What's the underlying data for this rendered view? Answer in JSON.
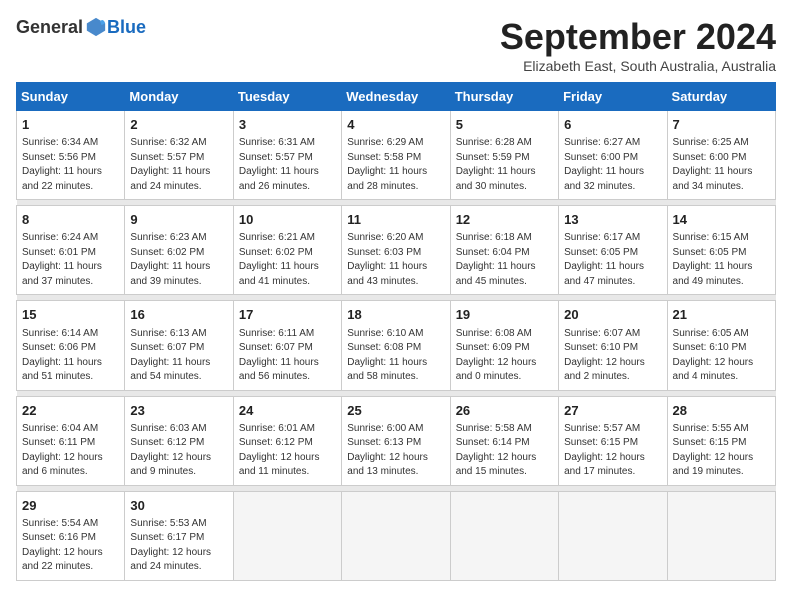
{
  "logo": {
    "general": "General",
    "blue": "Blue"
  },
  "title": {
    "month_year": "September 2024",
    "location": "Elizabeth East, South Australia, Australia"
  },
  "days_of_week": [
    "Sunday",
    "Monday",
    "Tuesday",
    "Wednesday",
    "Thursday",
    "Friday",
    "Saturday"
  ],
  "weeks": [
    [
      {
        "day": "1",
        "sunrise": "6:34 AM",
        "sunset": "5:56 PM",
        "daylight": "11 hours and 22 minutes."
      },
      {
        "day": "2",
        "sunrise": "6:32 AM",
        "sunset": "5:57 PM",
        "daylight": "11 hours and 24 minutes."
      },
      {
        "day": "3",
        "sunrise": "6:31 AM",
        "sunset": "5:57 PM",
        "daylight": "11 hours and 26 minutes."
      },
      {
        "day": "4",
        "sunrise": "6:29 AM",
        "sunset": "5:58 PM",
        "daylight": "11 hours and 28 minutes."
      },
      {
        "day": "5",
        "sunrise": "6:28 AM",
        "sunset": "5:59 PM",
        "daylight": "11 hours and 30 minutes."
      },
      {
        "day": "6",
        "sunrise": "6:27 AM",
        "sunset": "6:00 PM",
        "daylight": "11 hours and 32 minutes."
      },
      {
        "day": "7",
        "sunrise": "6:25 AM",
        "sunset": "6:00 PM",
        "daylight": "11 hours and 34 minutes."
      }
    ],
    [
      {
        "day": "8",
        "sunrise": "6:24 AM",
        "sunset": "6:01 PM",
        "daylight": "11 hours and 37 minutes."
      },
      {
        "day": "9",
        "sunrise": "6:23 AM",
        "sunset": "6:02 PM",
        "daylight": "11 hours and 39 minutes."
      },
      {
        "day": "10",
        "sunrise": "6:21 AM",
        "sunset": "6:02 PM",
        "daylight": "11 hours and 41 minutes."
      },
      {
        "day": "11",
        "sunrise": "6:20 AM",
        "sunset": "6:03 PM",
        "daylight": "11 hours and 43 minutes."
      },
      {
        "day": "12",
        "sunrise": "6:18 AM",
        "sunset": "6:04 PM",
        "daylight": "11 hours and 45 minutes."
      },
      {
        "day": "13",
        "sunrise": "6:17 AM",
        "sunset": "6:05 PM",
        "daylight": "11 hours and 47 minutes."
      },
      {
        "day": "14",
        "sunrise": "6:15 AM",
        "sunset": "6:05 PM",
        "daylight": "11 hours and 49 minutes."
      }
    ],
    [
      {
        "day": "15",
        "sunrise": "6:14 AM",
        "sunset": "6:06 PM",
        "daylight": "11 hours and 51 minutes."
      },
      {
        "day": "16",
        "sunrise": "6:13 AM",
        "sunset": "6:07 PM",
        "daylight": "11 hours and 54 minutes."
      },
      {
        "day": "17",
        "sunrise": "6:11 AM",
        "sunset": "6:07 PM",
        "daylight": "11 hours and 56 minutes."
      },
      {
        "day": "18",
        "sunrise": "6:10 AM",
        "sunset": "6:08 PM",
        "daylight": "11 hours and 58 minutes."
      },
      {
        "day": "19",
        "sunrise": "6:08 AM",
        "sunset": "6:09 PM",
        "daylight": "12 hours and 0 minutes."
      },
      {
        "day": "20",
        "sunrise": "6:07 AM",
        "sunset": "6:10 PM",
        "daylight": "12 hours and 2 minutes."
      },
      {
        "day": "21",
        "sunrise": "6:05 AM",
        "sunset": "6:10 PM",
        "daylight": "12 hours and 4 minutes."
      }
    ],
    [
      {
        "day": "22",
        "sunrise": "6:04 AM",
        "sunset": "6:11 PM",
        "daylight": "12 hours and 6 minutes."
      },
      {
        "day": "23",
        "sunrise": "6:03 AM",
        "sunset": "6:12 PM",
        "daylight": "12 hours and 9 minutes."
      },
      {
        "day": "24",
        "sunrise": "6:01 AM",
        "sunset": "6:12 PM",
        "daylight": "12 hours and 11 minutes."
      },
      {
        "day": "25",
        "sunrise": "6:00 AM",
        "sunset": "6:13 PM",
        "daylight": "12 hours and 13 minutes."
      },
      {
        "day": "26",
        "sunrise": "5:58 AM",
        "sunset": "6:14 PM",
        "daylight": "12 hours and 15 minutes."
      },
      {
        "day": "27",
        "sunrise": "5:57 AM",
        "sunset": "6:15 PM",
        "daylight": "12 hours and 17 minutes."
      },
      {
        "day": "28",
        "sunrise": "5:55 AM",
        "sunset": "6:15 PM",
        "daylight": "12 hours and 19 minutes."
      }
    ],
    [
      {
        "day": "29",
        "sunrise": "5:54 AM",
        "sunset": "6:16 PM",
        "daylight": "12 hours and 22 minutes."
      },
      {
        "day": "30",
        "sunrise": "5:53 AM",
        "sunset": "6:17 PM",
        "daylight": "12 hours and 24 minutes."
      },
      null,
      null,
      null,
      null,
      null
    ]
  ],
  "labels": {
    "sunrise": "Sunrise: ",
    "sunset": "Sunset: ",
    "daylight": "Daylight: "
  }
}
